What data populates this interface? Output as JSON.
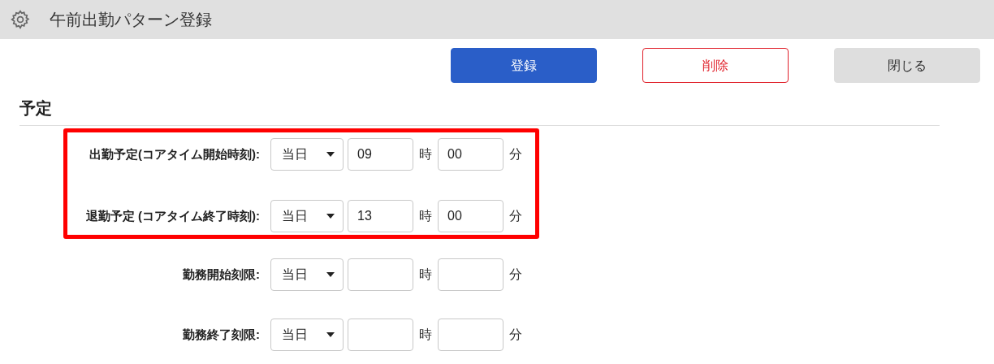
{
  "window": {
    "title": "午前出勤パターン登録"
  },
  "buttons": [
    {
      "label": "登録",
      "kind": "primary"
    },
    {
      "label": "削除",
      "kind": "danger"
    },
    {
      "label": "閉じる",
      "kind": "secondary"
    }
  ],
  "section": {
    "title": "予定"
  },
  "groups": [
    {
      "highlighted": true,
      "rows": [
        {
          "label": "出勤予定(コアタイム開始時刻):",
          "day": "当日",
          "hour": "09",
          "hour_unit": "時",
          "minute": "00",
          "minute_unit": "分"
        },
        {
          "label": "退勤予定 (コアタイム終了時刻):",
          "day": "当日",
          "hour": "13",
          "hour_unit": "時",
          "minute": "00",
          "minute_unit": "分"
        }
      ]
    },
    {
      "highlighted": false,
      "rows": [
        {
          "label": "勤務開始刻限:",
          "day": "当日",
          "hour_unit": "時",
          "minute_unit": "分"
        },
        {
          "label": "勤務終了刻限:",
          "day": "当日",
          "hour_unit": "時",
          "minute_unit": "分"
        }
      ]
    }
  ]
}
